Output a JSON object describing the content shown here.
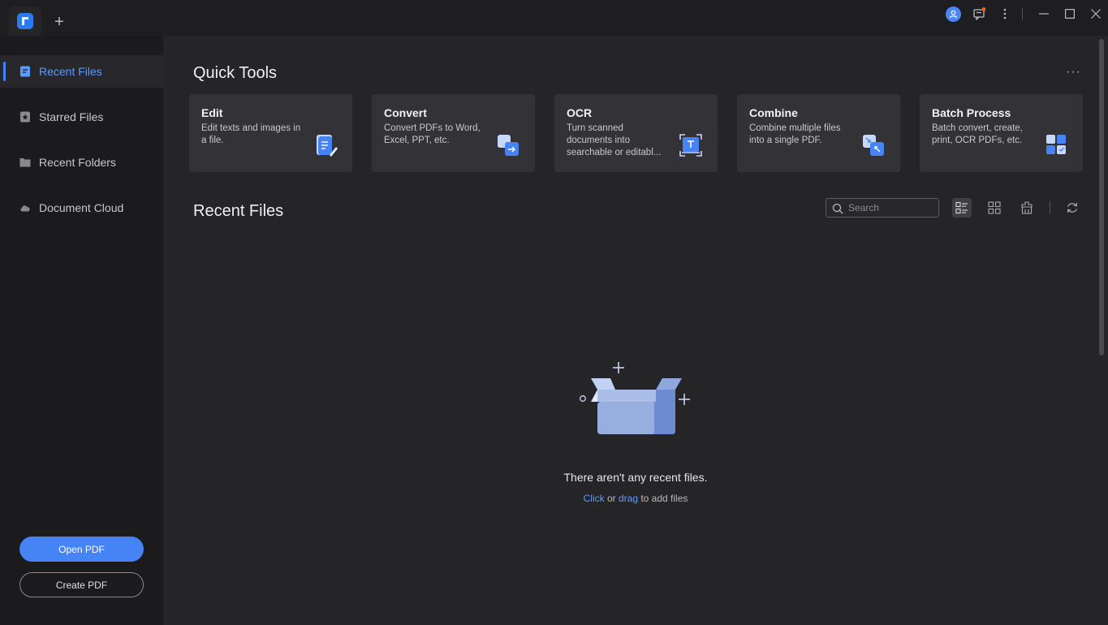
{
  "titlebar": {
    "new_tab": "+"
  },
  "sidebar": {
    "items": [
      {
        "label": "Recent Files",
        "icon": "recent-files-icon",
        "active": true
      },
      {
        "label": "Starred Files",
        "icon": "star-icon",
        "active": false
      },
      {
        "label": "Recent Folders",
        "icon": "folder-icon",
        "active": false
      },
      {
        "label": "Document Cloud",
        "icon": "cloud-icon",
        "active": false
      }
    ],
    "open_pdf": "Open PDF",
    "create_pdf": "Create PDF"
  },
  "quick_tools": {
    "heading": "Quick Tools",
    "more": "···",
    "cards": [
      {
        "title": "Edit",
        "desc": "Edit texts and images in a file."
      },
      {
        "title": "Convert",
        "desc": "Convert PDFs to Word, Excel, PPT, etc."
      },
      {
        "title": "OCR",
        "desc": "Turn scanned documents into searchable or editabl..."
      },
      {
        "title": "Combine",
        "desc": "Combine multiple files into a single PDF."
      },
      {
        "title": "Batch Process",
        "desc": "Batch convert, create, print, OCR PDFs, etc."
      }
    ]
  },
  "recent": {
    "heading": "Recent Files",
    "search_placeholder": "Search",
    "empty_title": "There aren't any recent files.",
    "empty_click": "Click",
    "empty_or": " or ",
    "empty_drag": "drag",
    "empty_rest": " to add files"
  },
  "colors": {
    "accent": "#4683f5",
    "bg": "#252528",
    "sidebar": "#1b1b1d",
    "card": "#333337"
  }
}
